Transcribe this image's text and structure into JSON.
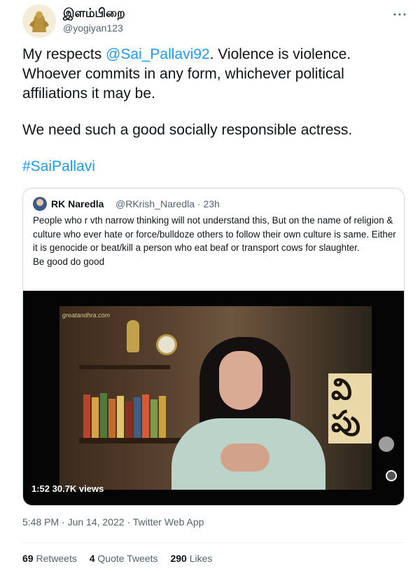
{
  "author": {
    "name": "இளம்பிறை",
    "handle": "@yogiyan123",
    "avatar_icon": "gold-figurine-avatar-icon",
    "more_icon": "more-options-icon"
  },
  "tweet": {
    "line1_prefix": "My respects ",
    "mention": "@Sai_Pallavi92",
    "line1_suffix": ". Violence is violence. Whoever commits in any form, whichever political affiliations it may be.",
    "line2": "We need such a good socially responsible actress.",
    "hashtag": "#SaiPallavi"
  },
  "quoted": {
    "name": "RK Naredla",
    "meta": "@RKrish_Naredla · 23h",
    "text": "People who r vth narrow thinking will not understand this, But on the name of religion & culture who ever hate or force/bulldoze others to follow their own culture is same. Either it is genocide or beat/kill a person who eat beaf or transport cows for slaughter.",
    "text2": "Be good do good",
    "video": {
      "watermark": "greatandhra.com",
      "duration_views": "1:52  30.7K views",
      "wall_text": "వి పు"
    }
  },
  "timestamp": "5:48 PM · Jun 14, 2022 · Twitter Web App",
  "stats": {
    "retweets_count": "69",
    "retweets_label": "Retweets",
    "quotes_count": "4",
    "quotes_label": "Quote Tweets",
    "likes_count": "290",
    "likes_label": "Likes"
  },
  "colors": {
    "link": "#1d9bf0",
    "text": "#0f1419",
    "muted": "#536471",
    "border": "#cfd9de"
  }
}
